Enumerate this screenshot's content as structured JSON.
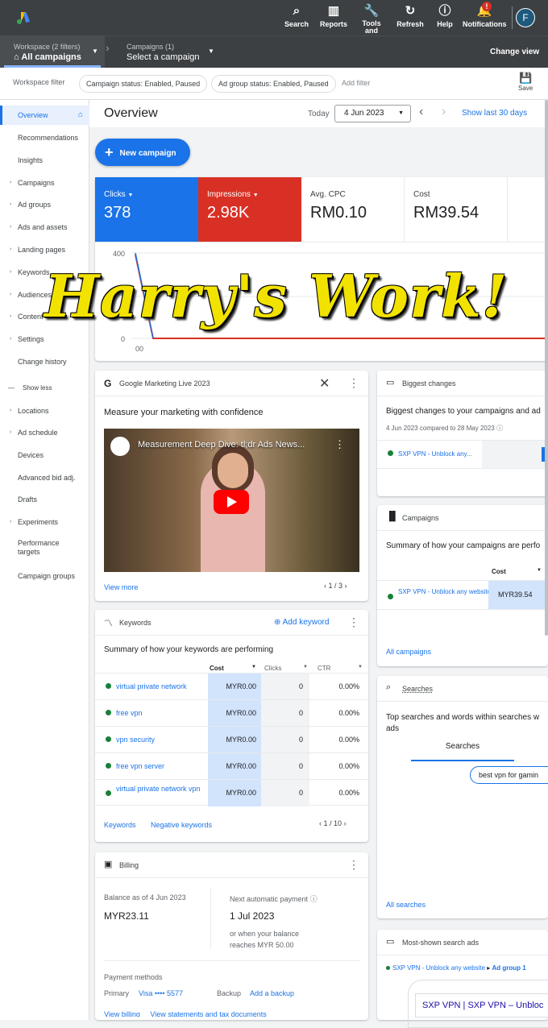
{
  "topbar": {
    "items": [
      {
        "label": "Search",
        "icon": "search-icon"
      },
      {
        "label": "Reports",
        "icon": "reports-icon"
      },
      {
        "label": "Tools and",
        "icon": "tools-icon"
      },
      {
        "label": "Refresh",
        "icon": "refresh-icon"
      },
      {
        "label": "Help",
        "icon": "help-icon"
      },
      {
        "label": "Notifications",
        "icon": "bell-icon"
      }
    ],
    "notif_badge": "!",
    "avatar": "F"
  },
  "workspace": {
    "label": "Workspace (2 filters)",
    "value": "All campaigns",
    "campaigns_label": "Campaigns (1)",
    "campaigns_value": "Select a campaign",
    "change_view": "Change view"
  },
  "filters": {
    "label": "Workspace filter",
    "chip1": "Campaign status: Enabled, Paused",
    "chip2": "Ad group status: Enabled, Paused",
    "add": "Add filter",
    "save": "Save"
  },
  "sidebar": {
    "items": [
      "Overview",
      "Recommendations",
      "Insights",
      "Campaigns",
      "Ad groups",
      "Ads and assets",
      "Landing pages",
      "Keywords",
      "Audiences",
      "Content",
      "Settings",
      "Change history"
    ],
    "show_less": "Show less",
    "more": [
      "Locations",
      "Ad schedule",
      "Devices",
      "Advanced bid adj.",
      "Drafts",
      "Experiments",
      "Performance targets",
      "Campaign groups"
    ]
  },
  "header": {
    "title": "Overview",
    "today": "Today",
    "date": "4 Jun 2023",
    "range": "Show last 30 days"
  },
  "new_campaign": "New campaign",
  "metrics": [
    {
      "label": "Clicks",
      "value": "378"
    },
    {
      "label": "Impressions",
      "value": "2.98K"
    },
    {
      "label": "Avg. CPC",
      "value": "RM0.10"
    },
    {
      "label": "Cost",
      "value": "RM39.54"
    }
  ],
  "chart_data": {
    "type": "line",
    "y_ticks": [
      "400",
      "2",
      "0"
    ],
    "x_ticks": [
      "00"
    ]
  },
  "watermark": "Harry's Work!",
  "gml": {
    "title": "Google Marketing Live 2023",
    "heading": "Measure your marketing with confidence",
    "video_title": "Measurement Deep Dive: tl;dr Ads News...",
    "view_more": "View more",
    "pager": "1 / 3"
  },
  "biggest": {
    "title": "Biggest changes",
    "heading": "Biggest changes to your campaigns and ad",
    "sub": "4 Jun 2023 compared to 28 May 2023",
    "row": "SXP VPN - Unblock any..."
  },
  "campaigns_card": {
    "title": "Campaigns",
    "heading": "Summary of how your campaigns are perfo",
    "col": "Cost",
    "row_name": "SXP VPN - Unblock any website",
    "row_cost": "MYR39.54",
    "link": "All campaigns"
  },
  "keywords": {
    "title": "Keywords",
    "add": "Add keyword",
    "heading": "Summary of how your keywords are performing",
    "cols": [
      "Cost",
      "Clicks",
      "CTR"
    ],
    "rows": [
      {
        "name": "virtual private network",
        "cost": "MYR0.00",
        "clicks": "0",
        "ctr": "0.00%"
      },
      {
        "name": "free vpn",
        "cost": "MYR0.00",
        "clicks": "0",
        "ctr": "0.00%"
      },
      {
        "name": "vpn security",
        "cost": "MYR0.00",
        "clicks": "0",
        "ctr": "0.00%"
      },
      {
        "name": "free vpn server",
        "cost": "MYR0.00",
        "clicks": "0",
        "ctr": "0.00%"
      },
      {
        "name": "virtual private network vpn",
        "cost": "MYR0.00",
        "clicks": "0",
        "ctr": "0.00%"
      }
    ],
    "link1": "Keywords",
    "link2": "Negative keywords",
    "pager": "1 / 10"
  },
  "searches": {
    "title": "Searches",
    "heading": "Top searches and words within searches w ads",
    "tab": "Searches",
    "chip": "best vpn for gamin",
    "link": "All searches"
  },
  "billing": {
    "title": "Billing",
    "bal_label": "Balance as of 4 Jun 2023",
    "bal": "MYR23.11",
    "next_label": "Next automatic payment",
    "next": "1 Jul 2023",
    "or": "or when your balance reaches MYR 50.00",
    "pm": "Payment methods",
    "primary": "Primary",
    "visa": "Visa •••• 5577",
    "backup": "Backup",
    "add_backup": "Add a backup",
    "links": "View billing     View statements and tax documents"
  },
  "ads": {
    "title": "Most-shown search ads",
    "crumb1": "SXP VPN - Unblock any website",
    "crumb2": "Ad group 1",
    "ad_title": "SXP VPN | SXP VPN – Unbloc"
  }
}
